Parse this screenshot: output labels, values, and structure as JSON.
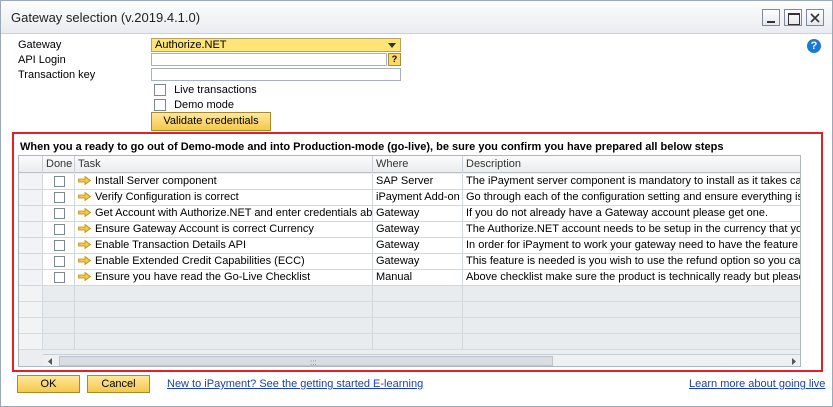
{
  "window": {
    "title": "Gateway selection (v.2019.4.1.0)"
  },
  "form": {
    "gateway_label": "Gateway",
    "gateway_value": "Authorize.NET",
    "api_login_label": "API Login",
    "api_login_value": "",
    "lookup_label": "?",
    "transaction_key_label": "Transaction key",
    "transaction_key_value": "",
    "live_transactions_label": "Live transactions",
    "live_transactions_checked": false,
    "demo_mode_label": "Demo mode",
    "demo_mode_checked": false,
    "validate_label": "Validate credentials"
  },
  "checklist": {
    "heading": "When you a ready to go out of Demo-mode and into Production-mode (go-live), be sure you confirm you have prepared all below steps",
    "columns": {
      "done": "Done",
      "task": "Task",
      "where": "Where",
      "description": "Description"
    },
    "rows": [
      {
        "done": false,
        "task": "Install Server component",
        "where": "SAP Server",
        "description": "The iPayment server component is mandatory to install as it takes care of v"
      },
      {
        "done": false,
        "task": "Verify Configuration is correct",
        "where": "iPayment Add-on",
        "description": "Go through each of the configuration setting and ensure everything is as e"
      },
      {
        "done": false,
        "task": "Get Account with Authorize.NET and enter credentials above",
        "where": "Gateway",
        "description": "If you do not already have a Gateway account please get one."
      },
      {
        "done": false,
        "task": "Ensure Gateway Account is correct Currency",
        "where": "Gateway",
        "description": "The Authorize.NET account needs to be setup in the currency that you wil"
      },
      {
        "done": false,
        "task": "Enable Transaction Details API",
        "where": "Gateway",
        "description": "In order for iPayment to work your gateway need to have the feature 'Tra"
      },
      {
        "done": false,
        "task": "Enable Extended Credit Capabilities (ECC)",
        "where": "Gateway",
        "description": "This feature is needed is you wish to use the refund option so you can skip"
      },
      {
        "done": false,
        "task": "Ensure you have read the Go-Live Checklist",
        "where": "Manual",
        "description": "Above checklist make sure the product is technically ready but please also"
      }
    ]
  },
  "footer": {
    "ok_label": "OK",
    "cancel_label": "Cancel",
    "elearning_link": "New to iPayment? See the getting started E-learning",
    "golive_link": "Learn more about going live"
  },
  "colors": {
    "accent_yellow": "#f5c84b",
    "highlight_border": "#e0202a",
    "link": "#1a3fb4",
    "help_blue": "#1a78d6"
  }
}
